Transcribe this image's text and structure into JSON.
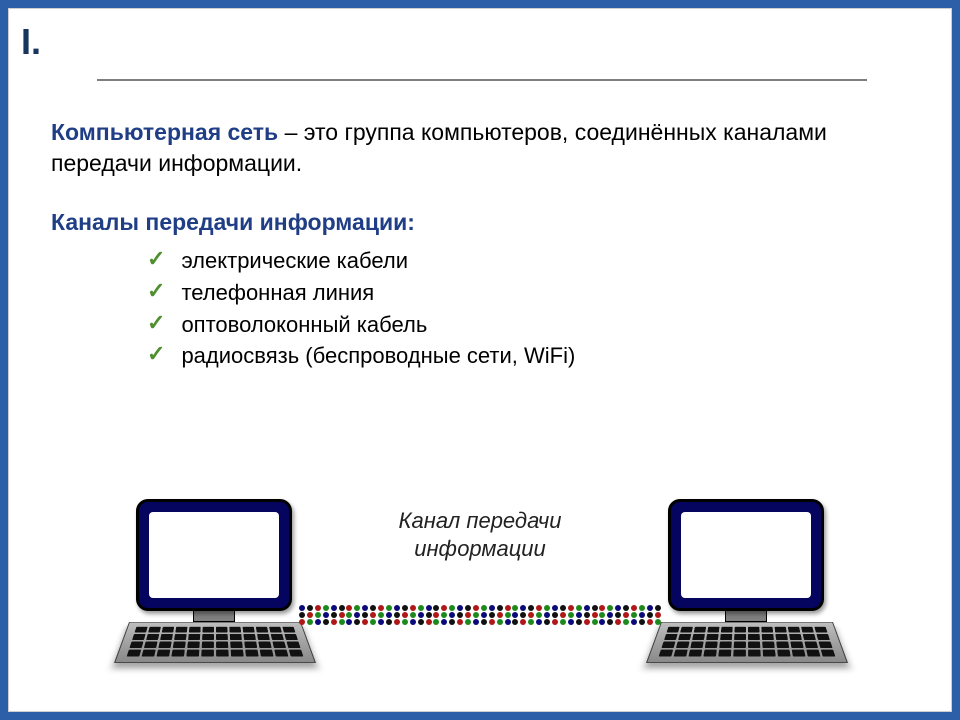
{
  "roman": "I.",
  "definition": {
    "term": "Компьютерная сеть",
    "rest": " – это группа компьютеров, соединённых каналами передачи информации."
  },
  "channels_heading": "Каналы передачи информации:",
  "channels": [
    "электрические кабели",
    "телефонная линия",
    "оптоволоконный кабель",
    "радиосвязь (беспроводные сети, WiFi)"
  ],
  "diagram_caption_line1": "Канал передачи",
  "diagram_caption_line2": "информации",
  "colors": {
    "term": "#1f3e86",
    "check": "#4f8f2e",
    "monitor": "#050560"
  }
}
